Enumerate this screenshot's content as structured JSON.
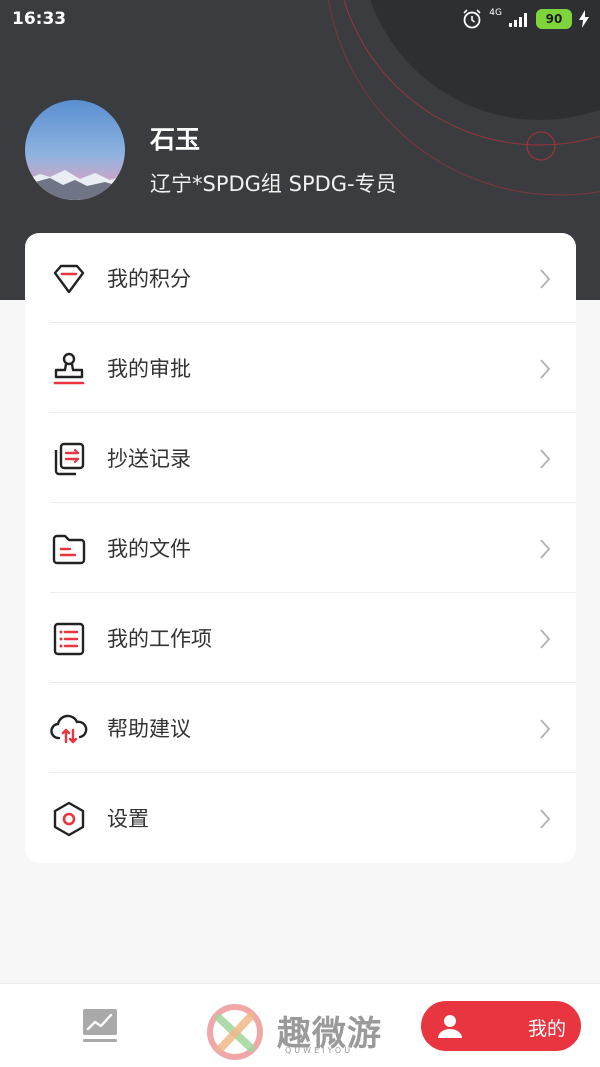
{
  "status_bar": {
    "time": "16:33",
    "network": "4G",
    "battery": "90"
  },
  "profile": {
    "name": "石玉",
    "role": "辽宁*SPDG组 SPDG-专员"
  },
  "menu": [
    {
      "label": "我的积分",
      "icon": "diamond-icon"
    },
    {
      "label": "我的审批",
      "icon": "stamp-icon"
    },
    {
      "label": "抄送记录",
      "icon": "copy-icon"
    },
    {
      "label": "我的文件",
      "icon": "folder-icon"
    },
    {
      "label": "我的工作项",
      "icon": "list-icon"
    },
    {
      "label": "帮助建议",
      "icon": "cloud-icon"
    },
    {
      "label": "设置",
      "icon": "settings-icon"
    }
  ],
  "bottom_nav": {
    "items": [
      {
        "label": "",
        "icon": "chart-icon"
      },
      {
        "label": "我的",
        "icon": "person-icon",
        "active": true
      }
    ]
  },
  "watermark": {
    "text": "趣微游",
    "sub": "QUWEIYOU"
  },
  "colors": {
    "accent": "#e8353f",
    "header_bg": "#3b3c40",
    "battery": "#7dd43b"
  }
}
